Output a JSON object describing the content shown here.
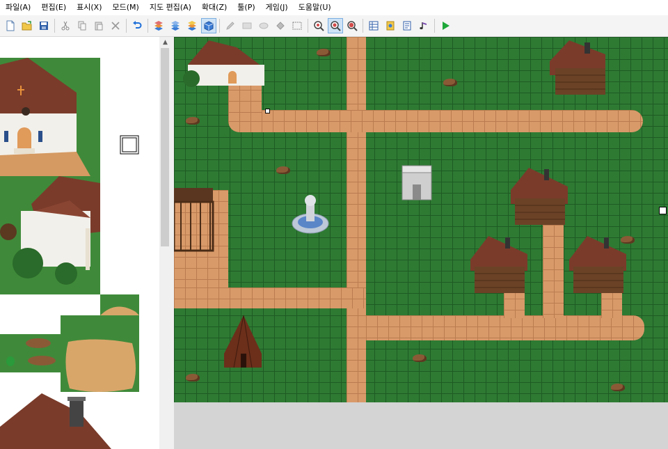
{
  "menu": [
    "파일(A)",
    "편집(E)",
    "표시(X)",
    "모드(M)",
    "지도 편집(A)",
    "확대(Z)",
    "툴(P)",
    "게임(J)",
    "도움말(U)"
  ],
  "toolbar": {
    "groups": [
      [
        "new-file-icon",
        "open-folder-icon",
        "save-disk-icon"
      ],
      [
        "cut-icon",
        "copy-icon",
        "paste-icon",
        "delete-icon"
      ],
      [
        "undo-icon"
      ],
      [
        "layer-1-icon",
        "layer-2-icon",
        "layer-3-icon",
        "events-layer-icon"
      ],
      [
        "pencil-icon",
        "rectangle-icon",
        "ellipse-icon",
        "fill-bucket-icon",
        "select-icon"
      ],
      [
        "zoom-1-icon",
        "zoom-2-icon",
        "zoom-4-icon"
      ],
      [
        "database-icon",
        "resources-icon",
        "script-icon",
        "sound-test-icon"
      ],
      [
        "playtest-icon"
      ]
    ],
    "active": [
      "events-layer-icon",
      "zoom-2-icon"
    ]
  },
  "colors": {
    "grass": "#2e7a33",
    "grid": "#1e5a23",
    "road": "#d99a6a",
    "roof": "#7a3b2a",
    "wood": "#6b4226",
    "accent": "#1e6fd8"
  }
}
